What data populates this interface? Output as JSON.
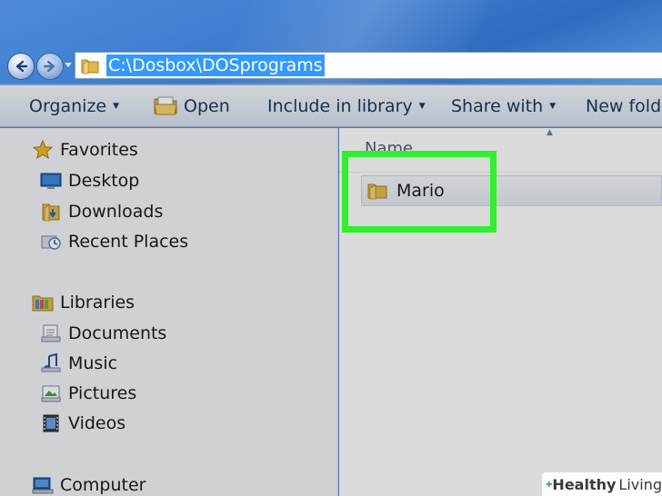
{
  "window": {
    "address_path": "C:\\Dosbox\\DOSprograms"
  },
  "toolbar": {
    "organize_label": "Organize",
    "open_label": "Open",
    "include_label": "Include in library",
    "share_label": "Share with",
    "new_folder_label": "New folde"
  },
  "sidebar": {
    "favorites": {
      "label": "Favorites",
      "icon": "star-icon",
      "items": [
        {
          "label": "Desktop",
          "icon": "desktop-icon"
        },
        {
          "label": "Downloads",
          "icon": "downloads-icon"
        },
        {
          "label": "Recent Places",
          "icon": "recent-places-icon"
        }
      ]
    },
    "libraries": {
      "label": "Libraries",
      "icon": "libraries-icon",
      "items": [
        {
          "label": "Documents",
          "icon": "documents-icon"
        },
        {
          "label": "Music",
          "icon": "music-icon"
        },
        {
          "label": "Pictures",
          "icon": "pictures-icon"
        },
        {
          "label": "Videos",
          "icon": "videos-icon"
        }
      ]
    },
    "computer": {
      "label": "Computer",
      "icon": "computer-icon"
    }
  },
  "main": {
    "column_header": "Name",
    "files": [
      {
        "name": "Mario",
        "type": "folder",
        "icon": "folder-icon"
      }
    ]
  },
  "colors": {
    "highlight": "#2ef02e",
    "selection": "#3399ff",
    "titlebar": "#3f7fd2"
  },
  "watermark": {
    "part1": "Healthy",
    "part2": "Living"
  }
}
